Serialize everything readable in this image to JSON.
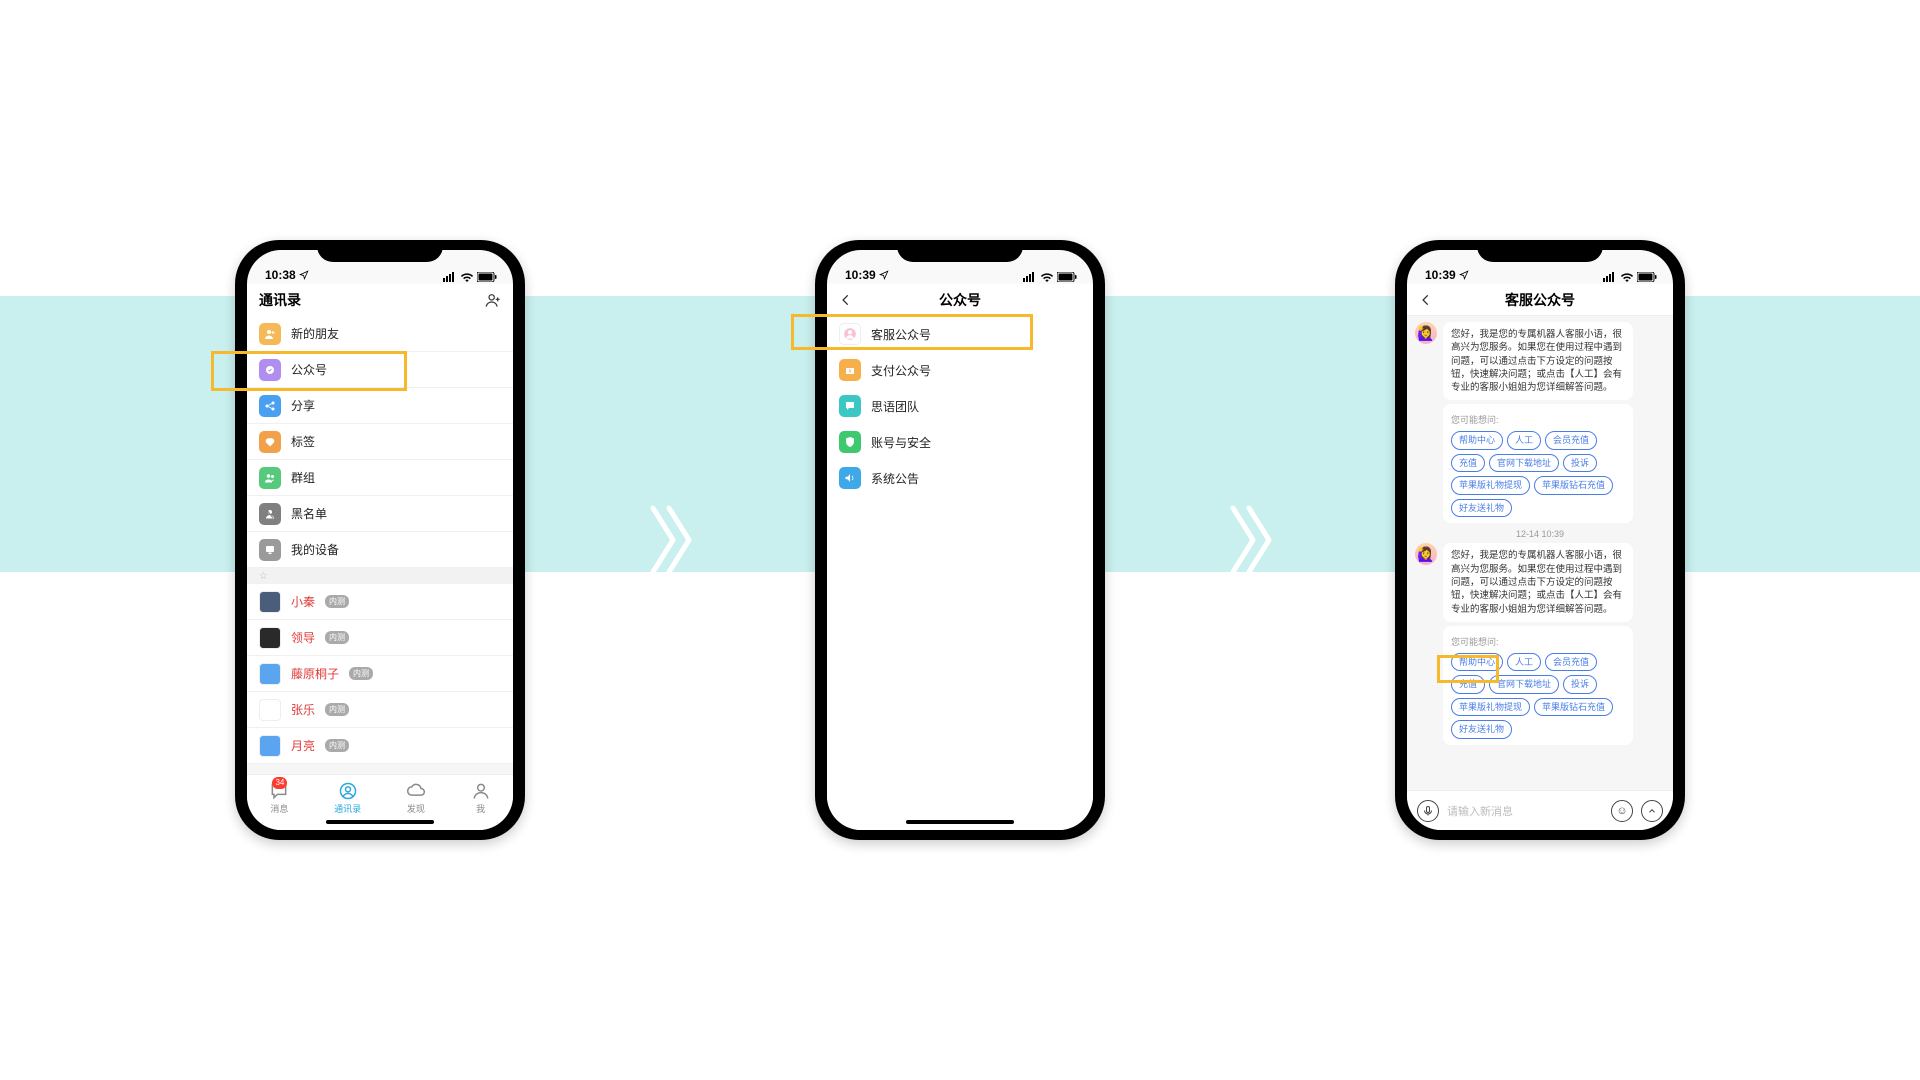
{
  "phone1": {
    "time": "10:38",
    "title": "通讯录",
    "menu": [
      {
        "label": "新的朋友",
        "color": "#f5ba57"
      },
      {
        "label": "公众号",
        "color": "#b08ef0"
      },
      {
        "label": "分享",
        "color": "#4aa0f0"
      },
      {
        "label": "标签",
        "color": "#f0a14a"
      },
      {
        "label": "群组",
        "color": "#55c97c"
      },
      {
        "label": "黑名单",
        "color": "#808080"
      },
      {
        "label": "我的设备",
        "color": "#9a9a9a"
      }
    ],
    "contacts": [
      {
        "label": "小秦",
        "badge": "内测"
      },
      {
        "label": "领导",
        "badge": "内测"
      },
      {
        "label": "藤原桐子",
        "badge": "内测"
      },
      {
        "label": "张乐",
        "badge": "内测"
      },
      {
        "label": "月亮",
        "badge": "内测"
      }
    ],
    "tabs": [
      {
        "label": "消息",
        "badge": "34"
      },
      {
        "label": "通讯录"
      },
      {
        "label": "发现"
      },
      {
        "label": "我"
      }
    ]
  },
  "phone2": {
    "time": "10:39",
    "title": "公众号",
    "rows": [
      {
        "label": "客服公众号",
        "color": "#f7c3cf"
      },
      {
        "label": "支付公众号",
        "color": "#f5b04a"
      },
      {
        "label": "思语团队",
        "color": "#3bc8c5"
      },
      {
        "label": "账号与安全",
        "color": "#3fc96e"
      },
      {
        "label": "系统公告",
        "color": "#3fa8e8"
      }
    ]
  },
  "phone3": {
    "time": "10:39",
    "title": "客服公众号",
    "bot_msg": "您好，我是您的专属机器人客服小语，很高兴为您服务。如果您在使用过程中遇到问题，可以通过点击下方设定的问题按钮，快速解决问题；或点击【人工】会有专业的客服小姐姐为您详细解答问题。",
    "hint": "您可能想问:",
    "hint2": "您可能想问:",
    "chips": [
      "帮助中心",
      "人工",
      "会员充值",
      "充值",
      "官网下载地址",
      "投诉",
      "苹果版礼物提现",
      "苹果版钻石充值",
      "好友送礼物"
    ],
    "timestamp": "12-14 10:39",
    "input_placeholder": "请输入新消息"
  }
}
